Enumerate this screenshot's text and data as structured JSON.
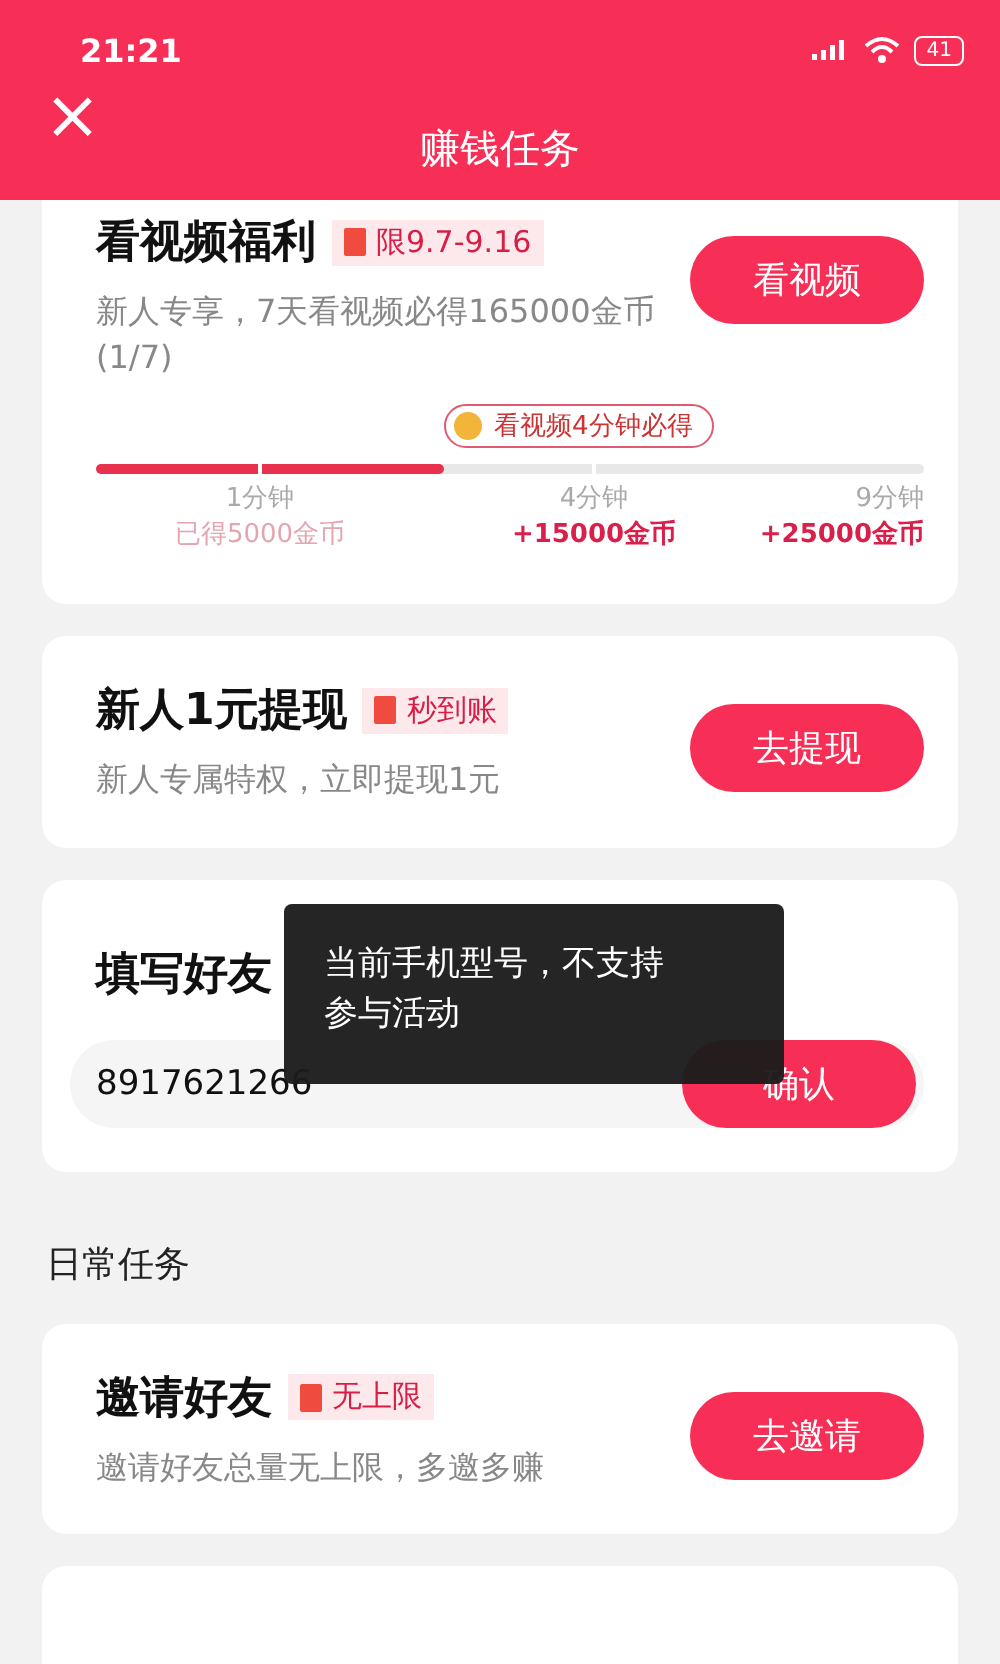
{
  "status_bar": {
    "time": "21:21",
    "battery": "41"
  },
  "header": {
    "close_icon": "×",
    "title": "赚钱任务"
  },
  "tasks": [
    {
      "kind": "progress",
      "title": "看视频福利",
      "badge": "限9.7-9.16",
      "description": "新人专享，7天看视频必得165000金币(1/7)",
      "button": "看视频",
      "tooltip": "看视频4分钟必得",
      "level": 0.42,
      "milestones": [
        {
          "time": "1分钟",
          "reward": "已得5000金币",
          "achieved": true
        },
        {
          "time": "4分钟",
          "reward": "+15000金币",
          "achieved": false
        },
        {
          "time": "9分钟",
          "reward": "+25000金币",
          "achieved": false
        }
      ]
    },
    {
      "kind": "simple",
      "title": "新人1元提现",
      "badge": "秒到账",
      "description": "新人专属特权，立即提现1元",
      "button": "去提现"
    },
    {
      "kind": "code",
      "title": "填写好友",
      "value": "8917621266",
      "button": "确认"
    }
  ],
  "section_title": "日常任务",
  "daily_tasks": [
    {
      "kind": "simple",
      "title": "邀请好友",
      "badge": "无上限",
      "description": "邀请好友总量无上限，多邀多赚",
      "button": "去邀请"
    },
    {
      "kind": "partial"
    }
  ],
  "toast": "当前手机型号，不支持参与活动"
}
